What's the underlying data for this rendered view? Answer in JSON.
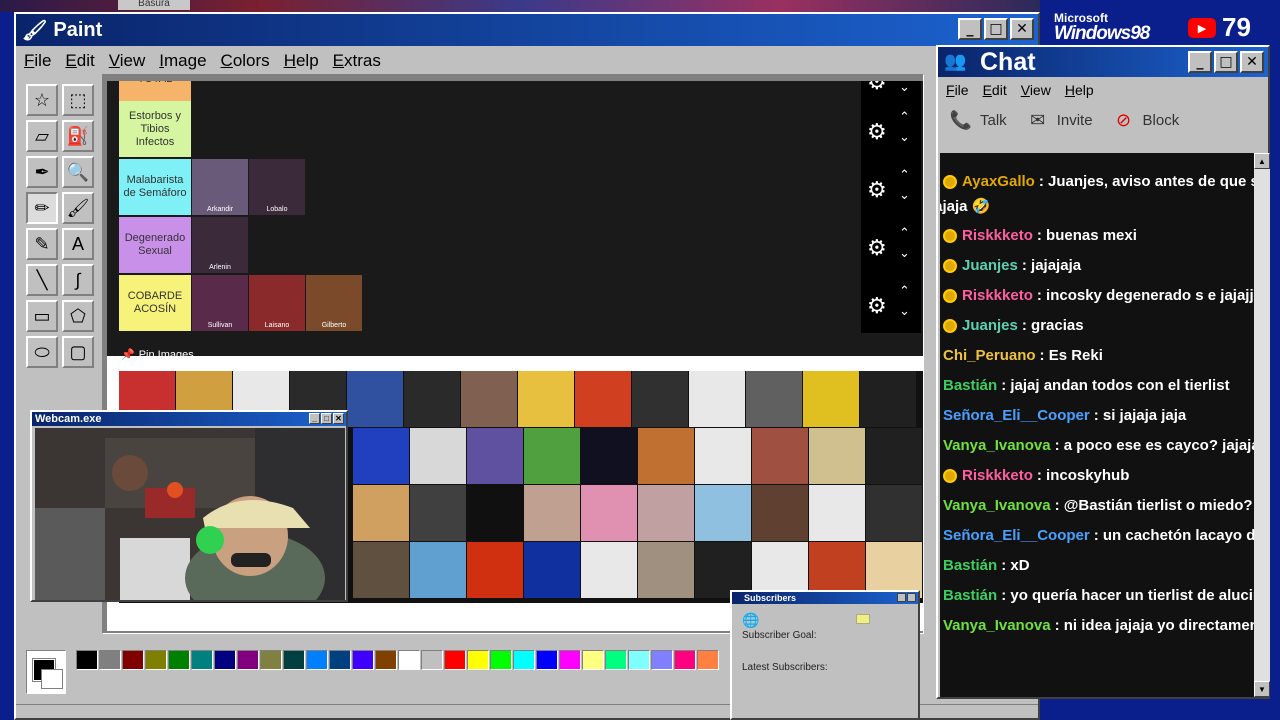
{
  "top_strip_label": "Basura",
  "paint": {
    "title": "Paint",
    "menu": [
      "File",
      "Edit",
      "View",
      "Image",
      "Colors",
      "Help",
      "Extras"
    ]
  },
  "tierlist": {
    "tiers": [
      {
        "label": "TOTAL",
        "color": "#f5b46a",
        "items": []
      },
      {
        "label": "Estorbos y Tibios Infectos",
        "color": "#d6f5a0",
        "items": []
      },
      {
        "label": "Malabarista de Semáforo",
        "color": "#7ff0f5",
        "items": [
          "Arkandir",
          "Lobalo"
        ]
      },
      {
        "label": "Degenerado Sexual",
        "color": "#c890e8",
        "items": [
          "Arlenin"
        ]
      },
      {
        "label": "COBARDE ACOSÍN",
        "color": "#f6f27a",
        "items": [
          "Sullivan",
          "Laisano",
          "Gilberto"
        ]
      }
    ],
    "pin_label": "Pin Images"
  },
  "webcam": {
    "title": "Webcam.exe"
  },
  "subscribers": {
    "title": "Subscribers",
    "goal_label": "Subscriber Goal:",
    "latest_label": "Latest Subscribers:"
  },
  "logo": {
    "microsoft": "Microsoft",
    "windows": "Windows98"
  },
  "viewer_count": "79",
  "chat": {
    "title": "Chat",
    "menu": [
      "File",
      "Edit",
      "View",
      "Help"
    ],
    "tools": [
      {
        "label": "Talk",
        "icon": "talk-icon"
      },
      {
        "label": "Invite",
        "icon": "invite-icon"
      },
      {
        "label": "Block",
        "icon": "block-icon"
      }
    ],
    "messages": [
      {
        "user": "AyaxGallo",
        "color": "#e0a800",
        "text": ": Juanjes, aviso antes de que s",
        "badge": true
      },
      {
        "user": "",
        "color": "#fff",
        "text": "jajaja 🤣",
        "badge": false,
        "cont": true
      },
      {
        "user": "Riskkketo",
        "color": "#ff5fa0",
        "text": ": buenas mexi",
        "badge": true
      },
      {
        "user": "Juanjes",
        "color": "#5cd0b0",
        "text": ": jajajaja",
        "badge": true
      },
      {
        "user": "Riskkketo",
        "color": "#ff5fa0",
        "text": ": incosky degenerado s e jajajjaj",
        "badge": true
      },
      {
        "user": "Juanjes",
        "color": "#5cd0b0",
        "text": ": gracias",
        "badge": true
      },
      {
        "user": "Chi_Peruano",
        "color": "#f0c040",
        "text": ": Es Reki",
        "badge": false
      },
      {
        "user": "Bastián",
        "color": "#3ccf60",
        "text": ": jajaj andan todos con el tierlist",
        "badge": false
      },
      {
        "user": "Señora_Eli__Cooper",
        "color": "#4aa0ff",
        "text": ": si jajaja jaja",
        "badge": false
      },
      {
        "user": "Vanya_Ivanova",
        "color": "#70e040",
        "text": ": a poco ese es cayco? jajajaja",
        "badge": false
      },
      {
        "user": "Riskkketo",
        "color": "#ff5fa0",
        "text": ": incoskyhub",
        "badge": true
      },
      {
        "user": "Vanya_Ivanova",
        "color": "#70e040",
        "text": ": @Bastián tierlist o miedo?",
        "badge": false
      },
      {
        "user": "Señora_Eli__Cooper",
        "color": "#4aa0ff",
        "text": ": un cachetón lacayo del m",
        "badge": false
      },
      {
        "user": "Bastián",
        "color": "#3ccf60",
        "text": ": xD",
        "badge": false
      },
      {
        "user": "Bastián",
        "color": "#3ccf60",
        "text": ": yo quería hacer un tierlist de alucines",
        "badge": false
      },
      {
        "user": "Vanya_Ivanova",
        "color": "#70e040",
        "text": ": ni idea jajaja yo directamente",
        "badge": false
      }
    ]
  },
  "palette": [
    "#000000",
    "#808080",
    "#800000",
    "#808000",
    "#008000",
    "#008080",
    "#000080",
    "#800080",
    "#808040",
    "#004040",
    "#0080ff",
    "#004080",
    "#4000ff",
    "#804000",
    "#ffffff",
    "#c0c0c0",
    "#ff0000",
    "#ffff00",
    "#00ff00",
    "#00ffff",
    "#0000ff",
    "#ff00ff",
    "#ffff80",
    "#00ff80",
    "#80ffff",
    "#8080ff",
    "#ff0080",
    "#ff8040"
  ]
}
